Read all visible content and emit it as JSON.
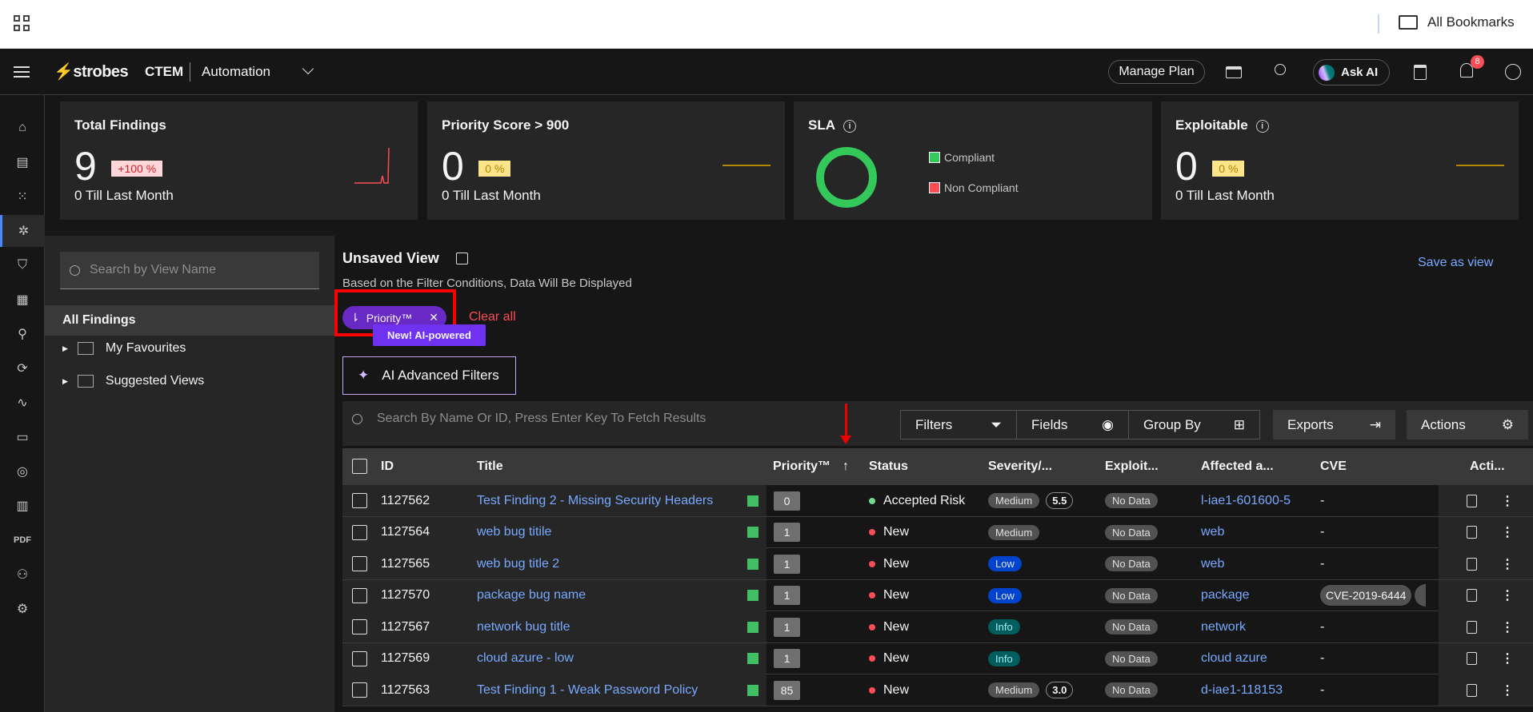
{
  "browser": {
    "bookmarks_label": "All Bookmarks"
  },
  "header": {
    "brand": "strobes",
    "product": "CTEM",
    "workspace": "Automation",
    "manage_plan": "Manage Plan",
    "ask_ai": "Ask AI",
    "notification_count": "8"
  },
  "cards": [
    {
      "title": "Total Findings",
      "value": "9",
      "delta": "+100 %",
      "subtitle": "0 Till Last Month"
    },
    {
      "title": "Priority Score > 900",
      "value": "0",
      "delta": "0 %",
      "subtitle": "0 Till Last Month"
    },
    {
      "title": "SLA",
      "legend": [
        "Compliant",
        "Non Compliant"
      ]
    },
    {
      "title": "Exploitable",
      "value": "0",
      "delta": "0 %",
      "subtitle": "0 Till Last Month"
    }
  ],
  "colors": {
    "compliant": "#34c759",
    "non_compliant": "#fa4d56",
    "accent": "#6929c4",
    "link": "#78a9ff"
  },
  "views": {
    "search_placeholder": "Search by View Name",
    "all_findings": "All Findings",
    "folders": [
      "My Favourites",
      "Suggested Views"
    ]
  },
  "view": {
    "title": "Unsaved View",
    "subtitle": "Based on the Filter Conditions, Data Will Be Displayed",
    "save_as_view": "Save as view",
    "sort_chip": "Priority™",
    "clear_all": "Clear all",
    "tooltip": "New! AI-powered",
    "ai_filters": "AI Advanced Filters"
  },
  "toolbar": {
    "search_placeholder": "Search By Name Or ID, Press Enter Key To Fetch Results",
    "filters": "Filters",
    "fields": "Fields",
    "group_by": "Group By",
    "exports": "Exports",
    "actions": "Actions"
  },
  "table": {
    "columns": [
      "ID",
      "Title",
      "Priority™",
      "Status",
      "Severity/...",
      "Exploit...",
      "Affected a...",
      "CVE",
      "Acti..."
    ],
    "rows": [
      {
        "id": "1127562",
        "title": "Test Finding 2 - Missing Security Headers",
        "priority": "0",
        "status": "Accepted Risk",
        "status_color": "#6fdc8c",
        "severity": "Medium",
        "score": "5.5",
        "exploit": "No Data",
        "asset": "l-iae1-601600-5",
        "cve": "-"
      },
      {
        "id": "1127564",
        "title": "web bug  titile",
        "priority": "1",
        "status": "New",
        "status_color": "#fa4d56",
        "severity": "Medium",
        "score": "",
        "exploit": "No Data",
        "asset": "web",
        "cve": "-"
      },
      {
        "id": "1127565",
        "title": "web bug title 2",
        "priority": "1",
        "status": "New",
        "status_color": "#fa4d56",
        "severity": "Low",
        "score": "",
        "exploit": "No Data",
        "asset": "web",
        "cve": "-"
      },
      {
        "id": "1127570",
        "title": "package bug  name",
        "priority": "1",
        "status": "New",
        "status_color": "#fa4d56",
        "severity": "Low",
        "score": "",
        "exploit": "No Data",
        "asset": "package",
        "cve": "CVE-2019-6444"
      },
      {
        "id": "1127567",
        "title": "network bug  title",
        "priority": "1",
        "status": "New",
        "status_color": "#fa4d56",
        "severity": "Info",
        "score": "",
        "exploit": "No Data",
        "asset": "network",
        "cve": "-"
      },
      {
        "id": "1127569",
        "title": "cloud azure - low",
        "priority": "1",
        "status": "New",
        "status_color": "#fa4d56",
        "severity": "Info",
        "score": "",
        "exploit": "No Data",
        "asset": "cloud azure",
        "cve": "-"
      },
      {
        "id": "1127563",
        "title": "Test Finding 1 - Weak Password Policy",
        "priority": "85",
        "status": "New",
        "status_color": "#fa4d56",
        "severity": "Medium",
        "score": "3.0",
        "exploit": "No Data",
        "asset": "d-iae1-118153",
        "cve": "-"
      }
    ]
  },
  "sidebar": {
    "pdf_label": "PDF"
  }
}
